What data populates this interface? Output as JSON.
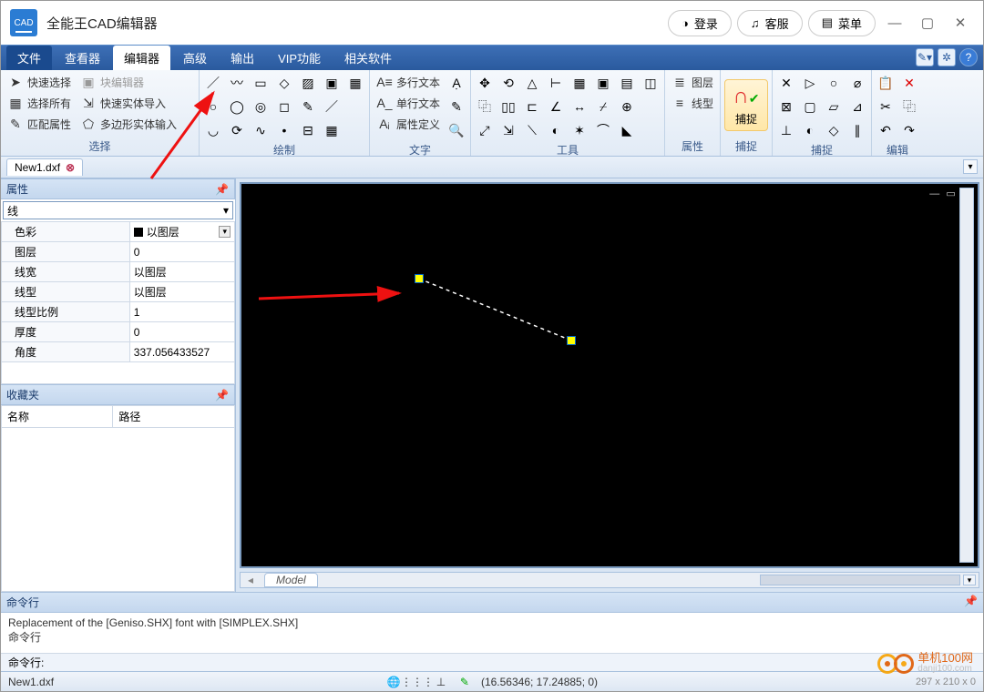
{
  "app": {
    "icon_label": "CAD",
    "title": "全能王CAD编辑器"
  },
  "title_buttons": {
    "login": "登录",
    "service": "客服",
    "menu": "菜单"
  },
  "menu_tabs": [
    "文件",
    "查看器",
    "编辑器",
    "高级",
    "输出",
    "VIP功能",
    "相关软件"
  ],
  "menu_active_index": 2,
  "ribbon": {
    "select": {
      "label": "选择",
      "quick": "快速选择",
      "all": "选择所有",
      "match": "匹配属性",
      "blockedit": "块编辑器",
      "solidimport": "快速实体导入",
      "polysolid": "多边形实体输入"
    },
    "draw": {
      "label": "绘制"
    },
    "text": {
      "label": "文字",
      "mtext": "多行文本",
      "stext": "单行文本",
      "attrdef": "属性定义"
    },
    "tools": {
      "label": "工具"
    },
    "props": {
      "label": "属性",
      "layers": "图层",
      "ltype": "线型"
    },
    "snap": {
      "label": "捕捉",
      "btn": "捕捉"
    },
    "snap2": {
      "label": "捕捉"
    },
    "edit": {
      "label": "编辑"
    }
  },
  "doc_tab": "New1.dxf",
  "panel_props": {
    "title": "属性",
    "type": "线",
    "rows": [
      {
        "k": "色彩",
        "v": "以图层",
        "combo": true
      },
      {
        "k": "图层",
        "v": "0"
      },
      {
        "k": "线宽",
        "v": "以图层"
      },
      {
        "k": "线型",
        "v": "以图层"
      },
      {
        "k": "线型比例",
        "v": "1"
      },
      {
        "k": "厚度",
        "v": "0"
      },
      {
        "k": "角度",
        "v": "337.056433527"
      }
    ]
  },
  "panel_fav": {
    "title": "收藏夹",
    "col1": "名称",
    "col2": "路径"
  },
  "model_tab": "Model",
  "cmd": {
    "title": "命令行",
    "history": "Replacement of the [Geniso.SHX] font with [SIMPLEX.SHX]",
    "line2": "命令行",
    "prompt": "命令行:"
  },
  "status": {
    "file": "New1.dxf",
    "coords": "(16.56346; 17.24885; 0)",
    "dims": "297 x 210 x 0"
  },
  "logo": {
    "brand": "单机100网",
    "sub": "danji100.com"
  }
}
